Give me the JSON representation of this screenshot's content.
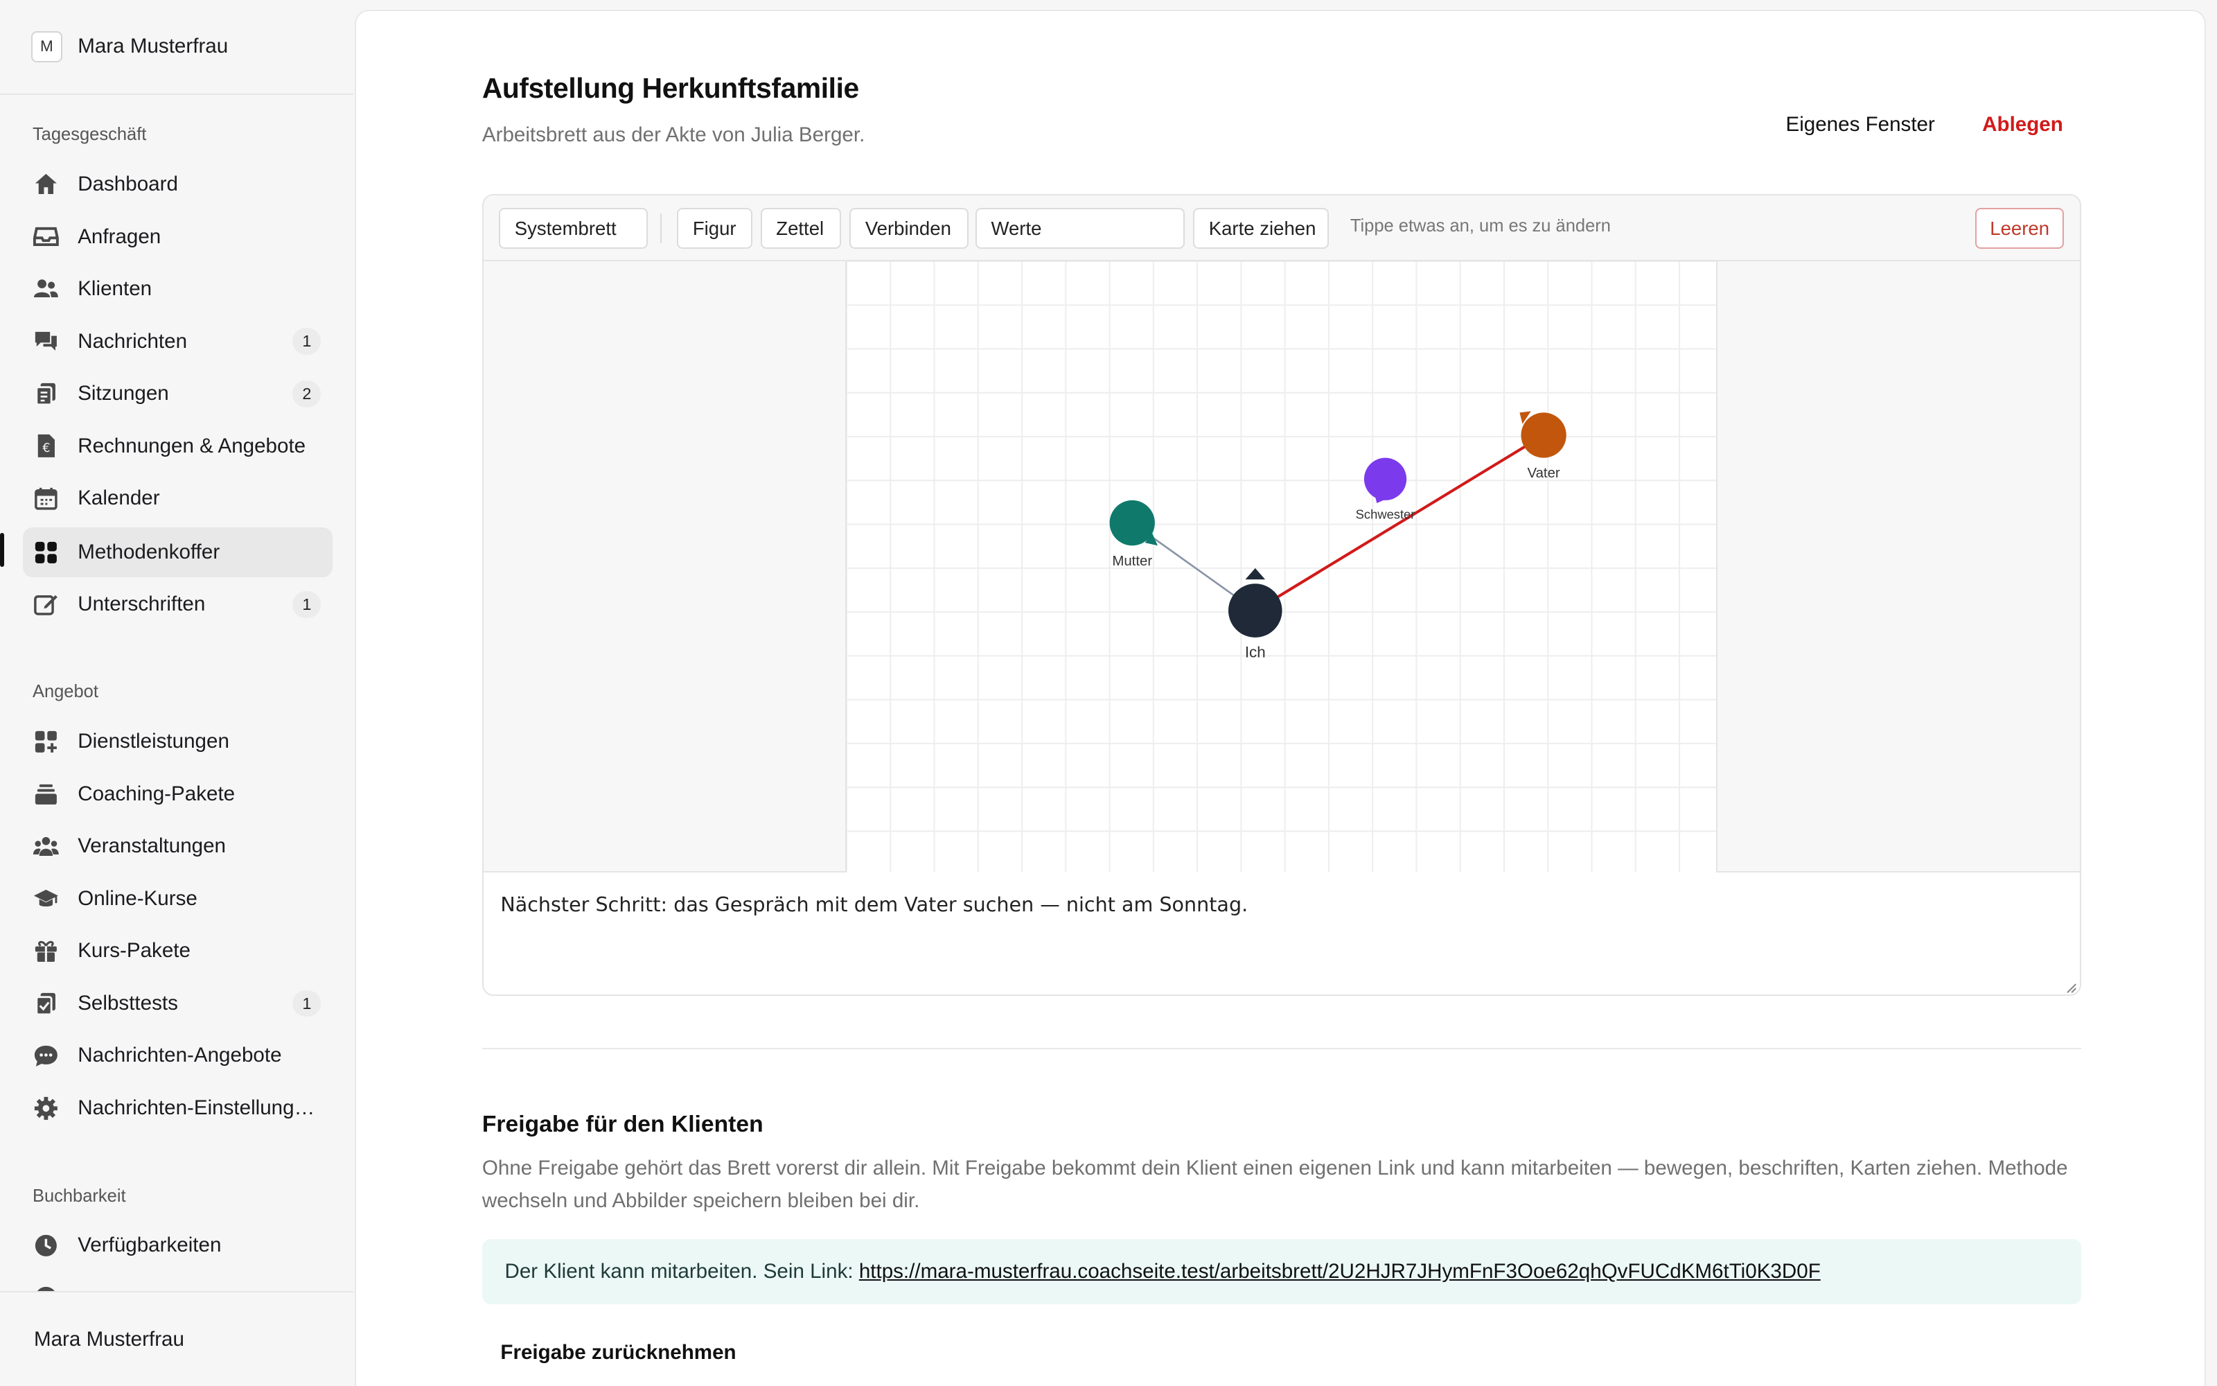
{
  "account": {
    "avatar_letter": "M",
    "name": "Mara Musterfrau"
  },
  "sidebar": {
    "sections": [
      {
        "title": "Tagesgeschäft",
        "items": [
          {
            "label": "Dashboard",
            "icon": "home-icon"
          },
          {
            "label": "Anfragen",
            "icon": "inbox-icon"
          },
          {
            "label": "Klienten",
            "icon": "users-icon"
          },
          {
            "label": "Nachrichten",
            "icon": "chat-icon",
            "badge": "1"
          },
          {
            "label": "Sitzungen",
            "icon": "sessions-icon",
            "badge": "2"
          },
          {
            "label": "Rechnungen & Angebote",
            "icon": "invoice-icon"
          },
          {
            "label": "Kalender",
            "icon": "calendar-icon"
          },
          {
            "label": "Methodenkoffer",
            "icon": "grid-icon",
            "active": true
          },
          {
            "label": "Unterschriften",
            "icon": "edit-icon",
            "badge": "1"
          }
        ]
      },
      {
        "title": "Angebot",
        "items": [
          {
            "label": "Dienstleistungen",
            "icon": "apps-plus-icon"
          },
          {
            "label": "Coaching-Pakete",
            "icon": "layers-icon"
          },
          {
            "label": "Veranstaltungen",
            "icon": "group-icon"
          },
          {
            "label": "Online-Kurse",
            "icon": "graduation-icon"
          },
          {
            "label": "Kurs-Pakete",
            "icon": "gift-icon"
          },
          {
            "label": "Selbsttests",
            "icon": "checklist-icon",
            "badge": "1"
          },
          {
            "label": "Nachrichten-Angebote",
            "icon": "message-dots-icon"
          },
          {
            "label": "Nachrichten-Einstellung…",
            "icon": "gear-icon"
          }
        ]
      },
      {
        "title": "Buchbarkeit",
        "items": [
          {
            "label": "Verfügbarkeiten",
            "icon": "clock-icon"
          }
        ]
      }
    ],
    "footer_name": "Mara Musterfrau"
  },
  "page": {
    "title": "Aufstellung Herkunftsfamilie",
    "subtitle": "Arbeitsbrett aus der Akte von Julia Berger.",
    "own_window_label": "Eigenes Fenster",
    "file_label": "Ablegen"
  },
  "toolbar": {
    "mode": "Systembrett",
    "figure": "Figur",
    "note": "Zettel",
    "connect": "Verbinden",
    "values": "Werte",
    "draw_card": "Karte ziehen",
    "hint": "Tippe etwas an, um es zu ändern",
    "clear": "Leeren"
  },
  "board": {
    "figures": [
      {
        "label": "Ich",
        "color": "#1f2937"
      },
      {
        "label": "Mutter",
        "color": "#0f7a6c"
      },
      {
        "label": "Schwester",
        "color": "#7c3aed"
      },
      {
        "label": "Vater",
        "color": "#c2560c"
      }
    ],
    "connections": [
      {
        "from": "Ich",
        "to": "Mutter",
        "color": "#8a94a6"
      },
      {
        "from": "Ich",
        "to": "Vater",
        "color": "#d11a1a"
      }
    ],
    "note_text": "Nächster Schritt: das Gespräch mit dem Vater suchen — nicht am Sonntag."
  },
  "sharing": {
    "title": "Freigabe für den Klienten",
    "description": "Ohne Freigabe gehört das Brett vorerst dir allein. Mit Freigabe bekommt dein Klient einen eigenen Link und kann mitarbeiten — bewegen, beschriften, Karten ziehen. Methode wechseln und Abbilder speichern bleiben bei dir.",
    "status_prefix": "Der Klient kann mitarbeiten. Sein Link:",
    "link": "https://mara-musterfrau.coachseite.test/arbeitsbrett/2U2HJR7JHymFnF3Ooe62qhQvFUCdKM6tTi0K3D0F",
    "revoke_label": "Freigabe zurücknehmen"
  }
}
